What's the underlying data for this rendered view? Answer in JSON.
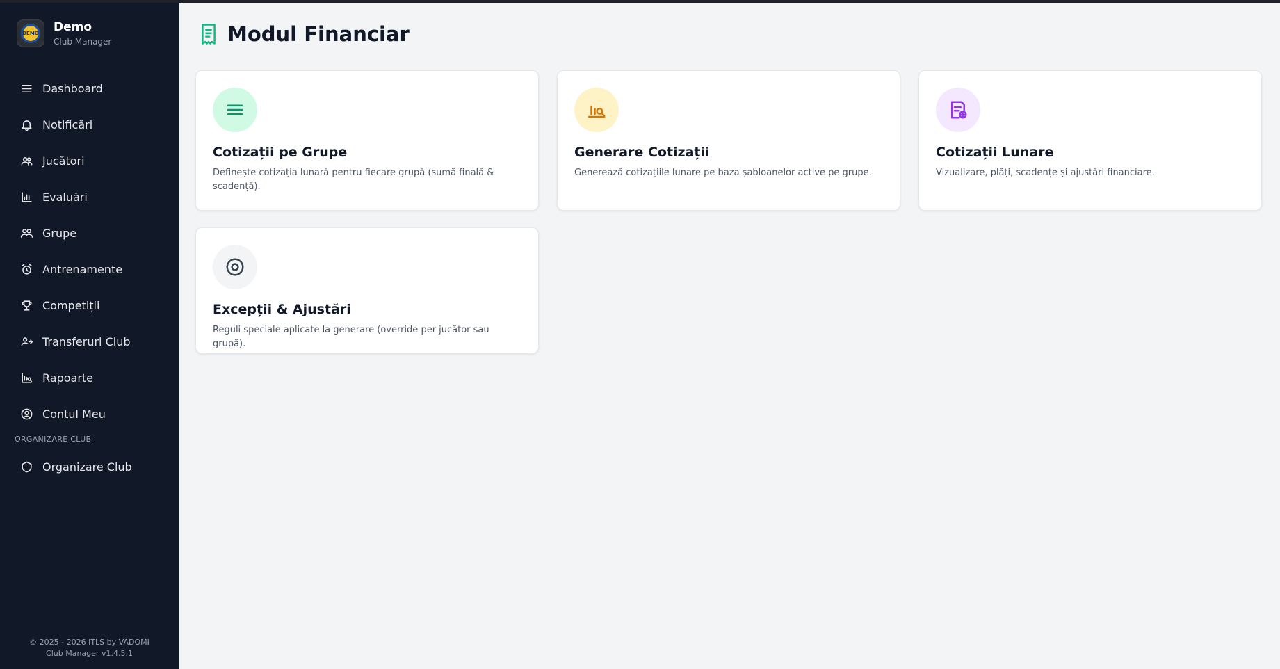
{
  "brand": {
    "title": "Demo",
    "subtitle": "Club Manager",
    "logo_text": "DEMO"
  },
  "sidebar": {
    "items": [
      {
        "label": "Dashboard",
        "icon": "menu-icon"
      },
      {
        "label": "Notificări",
        "icon": "bell-icon"
      },
      {
        "label": "Jucători",
        "icon": "users-icon"
      },
      {
        "label": "Evaluări",
        "icon": "bar-chart-icon"
      },
      {
        "label": "Grupe",
        "icon": "group-icon"
      },
      {
        "label": "Antrenamente",
        "icon": "alarm-clock-icon"
      },
      {
        "label": "Competiții",
        "icon": "trophy-icon"
      },
      {
        "label": "Transferuri Club",
        "icon": "user-transfer-icon"
      },
      {
        "label": "Rapoarte",
        "icon": "report-chart-icon"
      },
      {
        "label": "Contul Meu",
        "icon": "user-circle-icon"
      }
    ],
    "section_label": "ORGANIZARE CLUB",
    "section_items": [
      {
        "label": "Organizare Club",
        "icon": "shield-icon"
      }
    ]
  },
  "footer": {
    "line1": "© 2025 - 2026 ITLS by VADOMI",
    "line2": "Club Manager v1.4.5.1"
  },
  "page": {
    "title": "Modul Financiar",
    "icon": "receipt-icon"
  },
  "cards": [
    {
      "title": "Cotizații pe Grupe",
      "description": "Definește cotizația lunară pentru fiecare grupă (sumă finală & scadență).",
      "icon": "list-lines-icon",
      "icon_bg": "#d1fae5",
      "icon_color": "#059669"
    },
    {
      "title": "Generare Cotizații",
      "description": "Generează cotizațiile lunare pe baza șabloanelor active pe grupe.",
      "icon": "chart-search-icon",
      "icon_bg": "#fef3c7",
      "icon_color": "#d97706"
    },
    {
      "title": "Cotizații Lunare",
      "description": "Vizualizare, plăți, scadențe și ajustări financiare.",
      "icon": "document-add-icon",
      "icon_bg": "#f3e8ff",
      "icon_color": "#9333ea"
    },
    {
      "title": "Excepții & Ajustări",
      "description": "Reguli speciale aplicate la generare (override per jucător sau grupă).",
      "icon": "target-icon",
      "icon_bg": "#f3f4f6",
      "icon_color": "#374151"
    }
  ],
  "colors": {
    "sidebar_bg": "#111827",
    "page_bg": "#f3f4f6",
    "header_icon": "#10b981"
  }
}
